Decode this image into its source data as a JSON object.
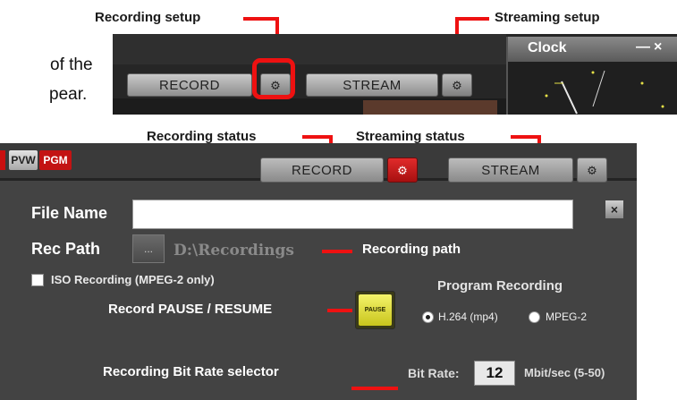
{
  "background_text": {
    "line1": "of the",
    "line2": "pear."
  },
  "annotations": {
    "recording_setup": "Recording setup",
    "streaming_setup": "Streaming setup",
    "recording_status": "Recording status",
    "streaming_status": "Streaming status",
    "recording_path": "Recording path",
    "record_pause_resume": "Record PAUSE / RESUME",
    "bitrate_selector": "Recording Bit Rate selector"
  },
  "top_toolbar": {
    "record_label": "RECORD",
    "stream_label": "STREAM",
    "gear_icon": "gear-icon"
  },
  "clock_window": {
    "title": "Clock",
    "minimize": "—",
    "close": "×"
  },
  "status_bar": {
    "pvw": "PVW",
    "pgm": "PGM",
    "record_label": "RECORD",
    "stream_label": "STREAM"
  },
  "recording_panel": {
    "file_name_label": "File Name",
    "file_name_value": "",
    "rec_path_label": "Rec Path",
    "browse_label": "...",
    "rec_path_value": "D:\\Recordings",
    "iso_label": "ISO Recording (MPEG-2 only)",
    "iso_checked": false,
    "pause_label": "PAUSE",
    "program_recording_title": "Program Recording",
    "format_options": [
      "H.264 (mp4)",
      "MPEG-2"
    ],
    "format_selected": "H.264 (mp4)",
    "bitrate_label": "Bit Rate:",
    "bitrate_value": "12",
    "bitrate_unit": "Mbit/sec (5-50)",
    "close_label": "×"
  },
  "colors": {
    "accent_red": "#ee1111",
    "panel_bg": "#434343",
    "pause_yellow": "#e6e24a"
  }
}
